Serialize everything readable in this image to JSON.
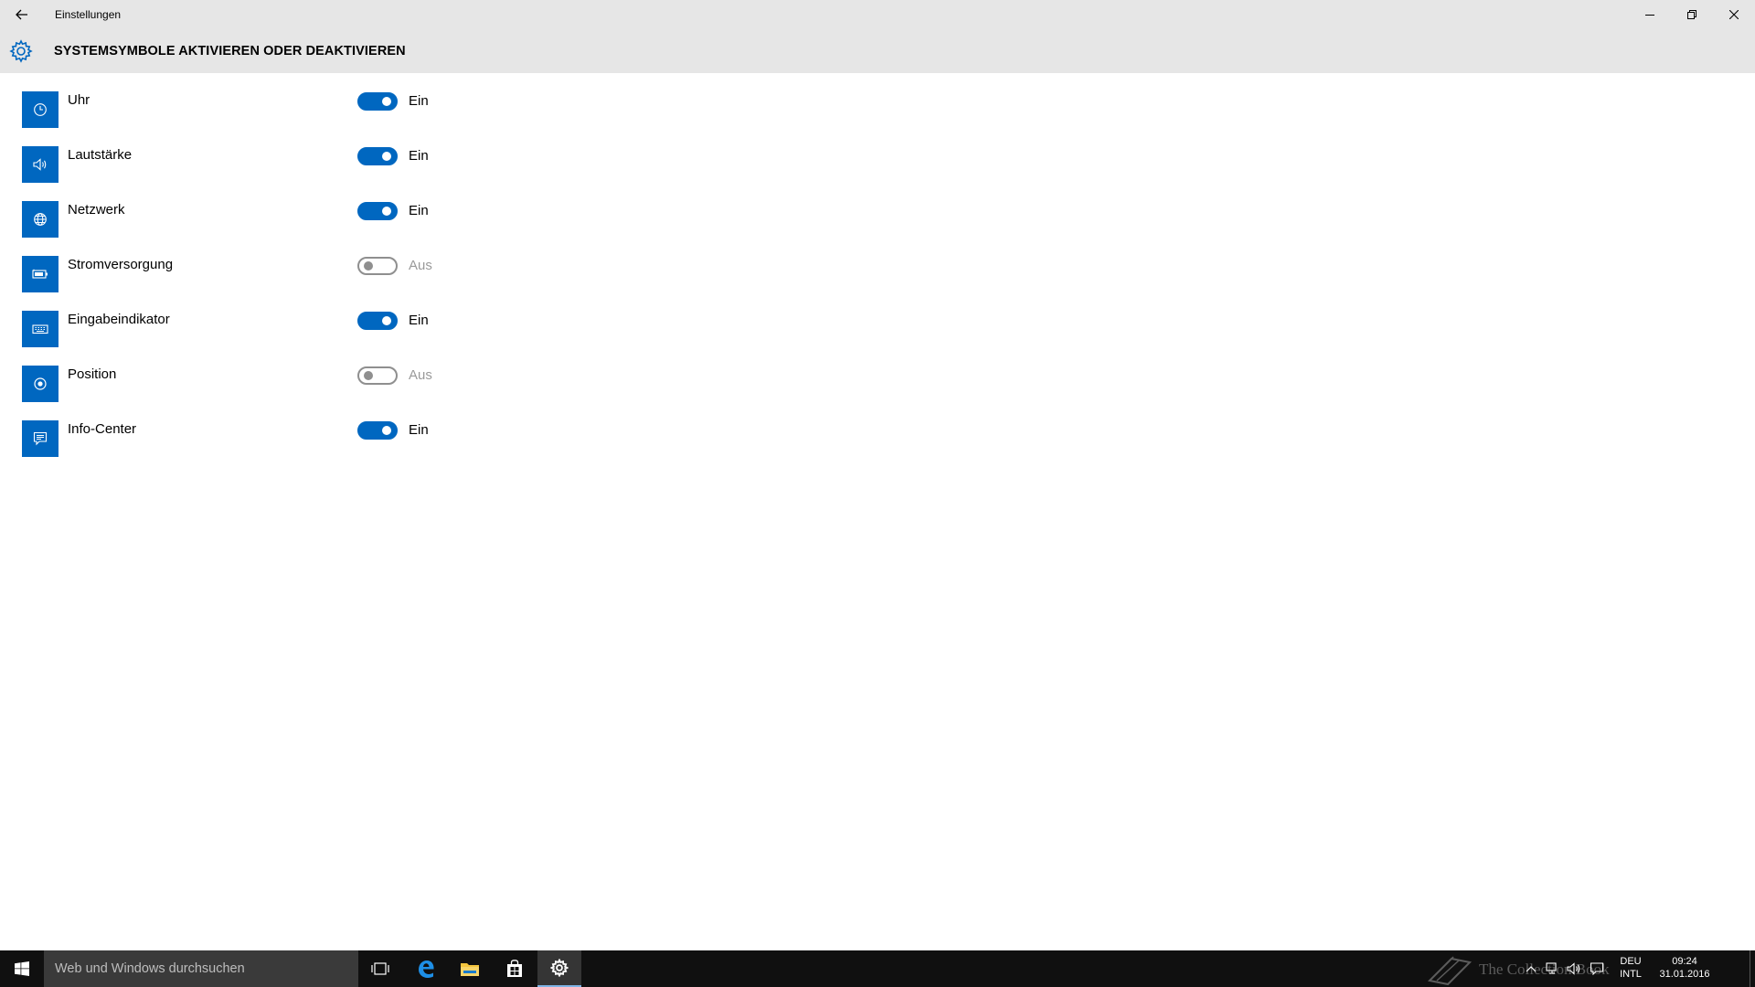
{
  "window": {
    "title": "Einstellungen",
    "controls": {
      "minimize_icon": "minimize-icon",
      "restore_icon": "restore-icon",
      "close_icon": "close-icon"
    }
  },
  "header": {
    "icon": "gear-icon",
    "title": "SYSTEMSYMBOLE AKTIVIEREN ODER DEAKTIVIEREN"
  },
  "settings": [
    {
      "id": "uhr",
      "icon": "clock-icon",
      "label": "Uhr",
      "enabled": true,
      "state": "Ein"
    },
    {
      "id": "lautstaerke",
      "icon": "volume-icon",
      "label": "Lautstärke",
      "enabled": true,
      "state": "Ein"
    },
    {
      "id": "netzwerk",
      "icon": "network-icon",
      "label": "Netzwerk",
      "enabled": true,
      "state": "Ein"
    },
    {
      "id": "stromversorgung",
      "icon": "battery-icon",
      "label": "Stromversorgung",
      "enabled": false,
      "state": "Aus"
    },
    {
      "id": "eingabeindikator",
      "icon": "keyboard-icon",
      "label": "Eingabeindikator",
      "enabled": true,
      "state": "Ein"
    },
    {
      "id": "position",
      "icon": "location-icon",
      "label": "Position",
      "enabled": false,
      "state": "Aus"
    },
    {
      "id": "info-center",
      "icon": "action-center-icon",
      "label": "Info-Center",
      "enabled": true,
      "state": "Ein"
    }
  ],
  "taskbar": {
    "search_placeholder": "Web und Windows durchsuchen",
    "pinned": [
      "task-view-icon",
      "edge-icon",
      "file-explorer-icon",
      "store-icon",
      "settings-icon"
    ],
    "active_app": "settings-icon",
    "tray": {
      "language": "DEU",
      "layout": "INTL",
      "time": "09:24",
      "date": "31.01.2016",
      "watermark": "The Collection Book"
    }
  },
  "colors": {
    "accent": "#0067c0",
    "titlebar": "#e6e6e6",
    "taskbar": "#101010",
    "toggle_off": "#8f8f8f"
  }
}
